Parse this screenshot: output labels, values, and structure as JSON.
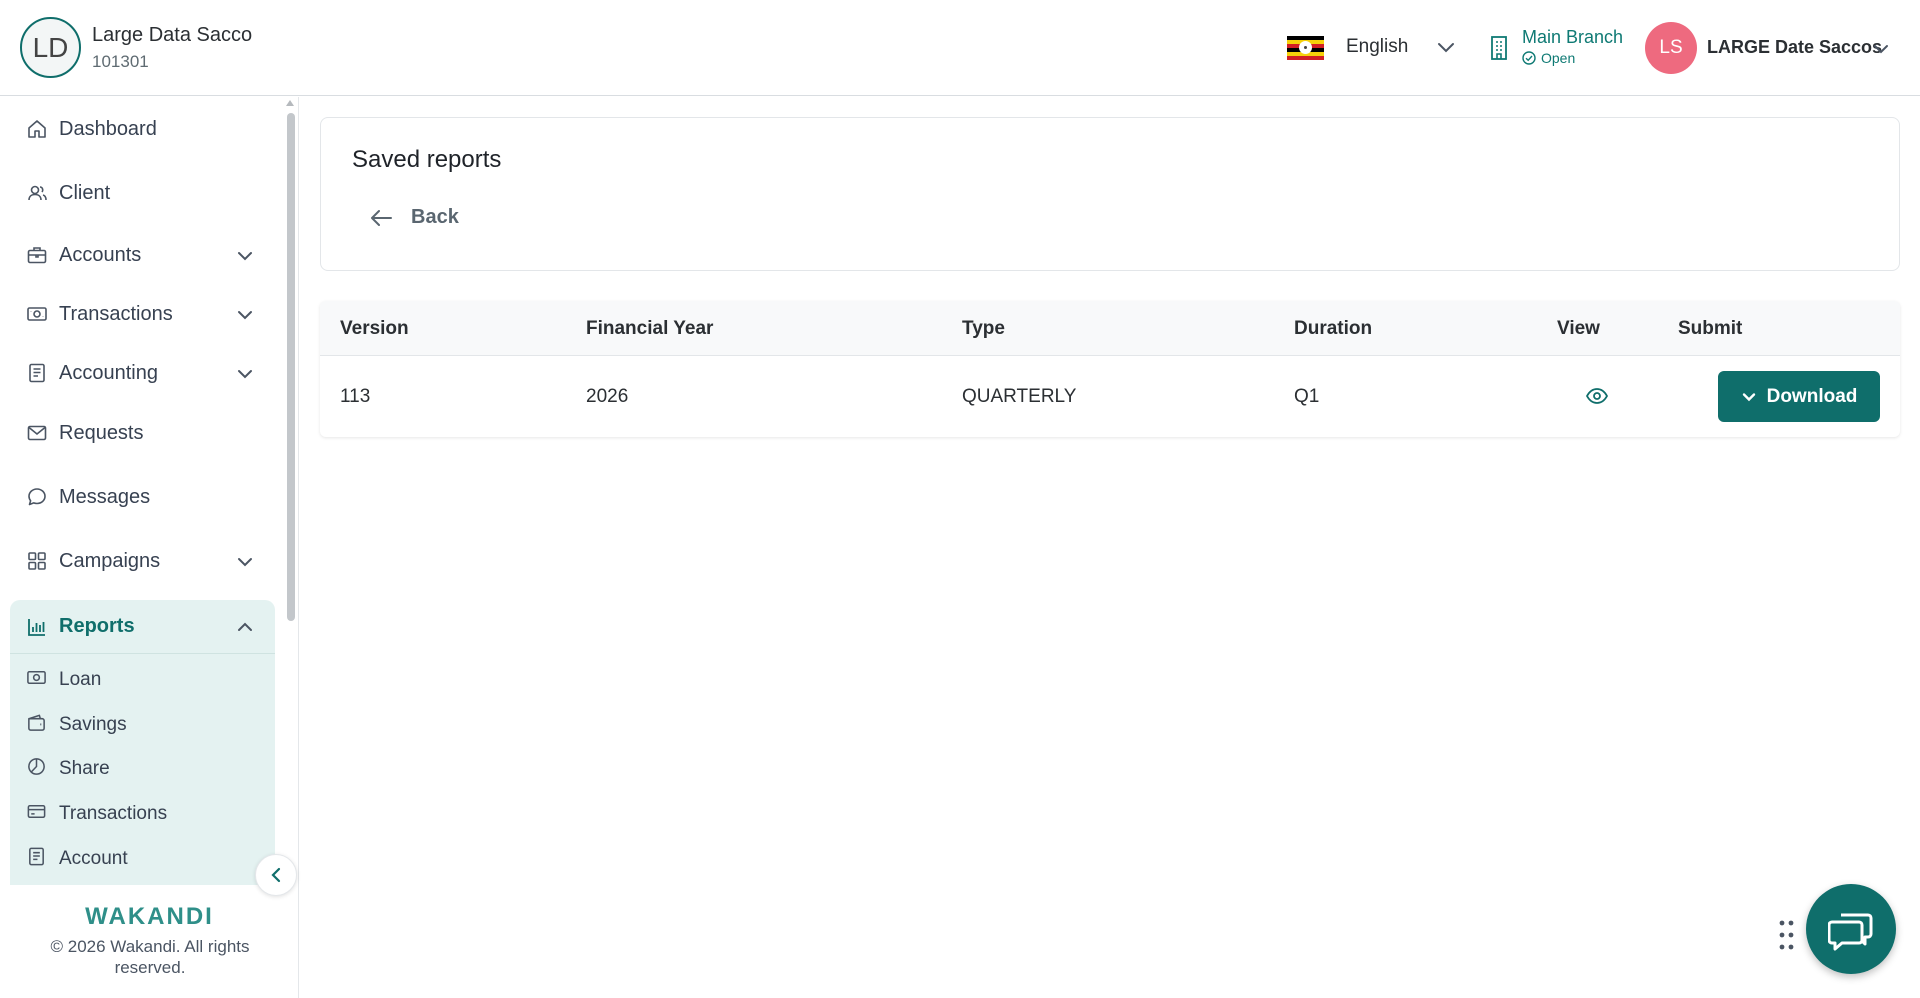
{
  "header": {
    "org_initials": "LD",
    "org_name": "Large Data Sacco",
    "org_code": "101301",
    "language": "English",
    "branch_name": "Main Branch",
    "branch_status": "Open",
    "user_initials": "LS",
    "user_name": "LARGE Date Saccos"
  },
  "sidebar": {
    "items": [
      {
        "label": "Dashboard",
        "icon": "home-icon"
      },
      {
        "label": "Client",
        "icon": "users-icon"
      },
      {
        "label": "Accounts",
        "icon": "briefcase-icon"
      },
      {
        "label": "Transactions",
        "icon": "banknote-icon"
      },
      {
        "label": "Accounting",
        "icon": "ledger-icon"
      },
      {
        "label": "Requests",
        "icon": "mail-icon"
      },
      {
        "label": "Messages",
        "icon": "chat-bubble-icon"
      },
      {
        "label": "Campaigns",
        "icon": "grid-icon"
      }
    ],
    "reports": {
      "label": "Reports",
      "icon": "bar-chart-icon",
      "sub_items": [
        {
          "label": "Loan",
          "icon": "banknote-icon"
        },
        {
          "label": "Savings",
          "icon": "wallet-icon"
        },
        {
          "label": "Share",
          "icon": "pie-chart-icon"
        },
        {
          "label": "Transactions",
          "icon": "card-icon"
        },
        {
          "label": "Account",
          "icon": "document-icon"
        }
      ]
    },
    "brand": "WAKANDI",
    "copyright": "© 2026 Wakandi. All rights reserved."
  },
  "main": {
    "title": "Saved reports",
    "back_label": "Back",
    "table": {
      "headers": [
        "Version",
        "Financial Year",
        "Type",
        "Duration",
        "View",
        "Submit"
      ],
      "rows": [
        {
          "version": "113",
          "financial_year": "2026",
          "type": "QUARTERLY",
          "duration": "Q1"
        }
      ],
      "download_label": "Download"
    }
  },
  "colors": {
    "primary": "#0f6e6b",
    "avatar": "#ee6a7f",
    "reports_bg": "#e4f2f1"
  }
}
